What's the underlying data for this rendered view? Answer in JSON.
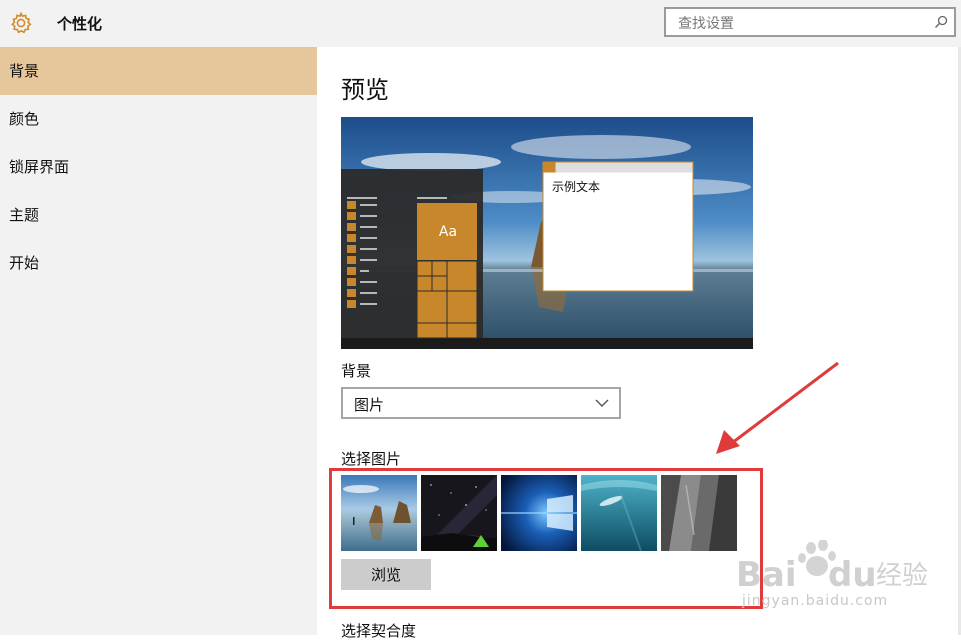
{
  "app": {
    "title": "个性化"
  },
  "search": {
    "placeholder": "查找设置"
  },
  "sidebar": {
    "items": [
      {
        "label": "背景"
      },
      {
        "label": "颜色"
      },
      {
        "label": "锁屏界面"
      },
      {
        "label": "主题"
      },
      {
        "label": "开始"
      }
    ]
  },
  "main": {
    "preview_heading": "预览",
    "preview": {
      "sample_text": "示例文本",
      "tile_label": "Aa"
    },
    "background_label": "背景",
    "background_value": "图片",
    "choose_picture_label": "选择图片",
    "browse_label": "浏览",
    "fit_label": "选择契合度"
  },
  "colors": {
    "accent": "#e6c79c",
    "tile": "#c8872a",
    "annotation": "#e03a3a"
  },
  "watermark": {
    "logo_text": "Baidu经验",
    "url": "jingyan.baidu.com"
  }
}
